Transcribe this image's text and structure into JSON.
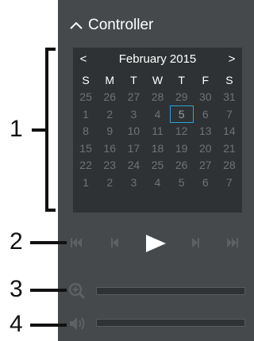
{
  "header": {
    "title": "Controller",
    "icon": "chevron-up-icon"
  },
  "calendar": {
    "month_label": "February 2015",
    "prev": "<",
    "next": ">",
    "weekdays": [
      "S",
      "M",
      "T",
      "W",
      "T",
      "F",
      "S"
    ],
    "weeks": [
      [
        "25",
        "26",
        "27",
        "28",
        "29",
        "30",
        "31"
      ],
      [
        "1",
        "2",
        "3",
        "4",
        "5",
        "6",
        "7"
      ],
      [
        "8",
        "9",
        "10",
        "11",
        "12",
        "13",
        "14"
      ],
      [
        "15",
        "16",
        "17",
        "18",
        "19",
        "20",
        "21"
      ],
      [
        "22",
        "23",
        "24",
        "25",
        "26",
        "27",
        "28"
      ],
      [
        "1",
        "2",
        "3",
        "4",
        "5",
        "6",
        "7"
      ]
    ],
    "selected_day": "5",
    "selected_color": "#2aa3d8"
  },
  "callouts": {
    "c1": "1",
    "c2": "2",
    "c3": "3",
    "c4": "4"
  },
  "playback": {
    "icons": [
      "skip-first-icon",
      "step-back-icon",
      "play-icon",
      "step-forward-icon",
      "skip-last-icon"
    ]
  },
  "zoom": {
    "icon": "zoom-in-icon"
  },
  "volume": {
    "icon": "volume-icon"
  },
  "colors": {
    "panel": "#45494c",
    "calendar_bg": "#2f3234",
    "muted_day": "#6f7376",
    "controls": "#5d6164"
  }
}
